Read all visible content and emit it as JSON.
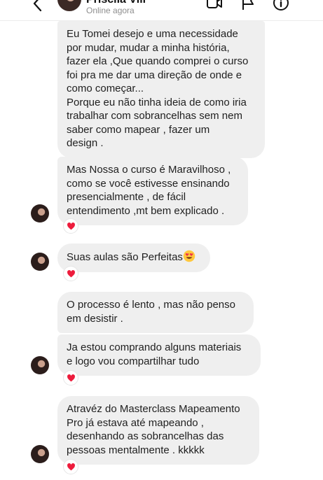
{
  "header": {
    "contact_name": "Priscila Vili",
    "status": "Online agora",
    "icons": [
      "back-chevron-icon",
      "video-call-icon",
      "flag-icon",
      "info-icon"
    ]
  },
  "messages": [
    {
      "text": "Eu Tomei desejo e uma necessidade\npor mudar, mudar a minha história,\nfazer ela ,Que quando comprei o curso\nfoi pra me dar uma direção de onde e\ncomo começar...\nPorque eu não tinha ideia de como iria\ntrabalhar com sobrancelhas sem nem\nsaber como mapear , fazer um\ndesign ."
    },
    {
      "text": "Mas Nossa o curso é Maravilhoso ,\ncomo se você estivesse ensinando\npresencialmente , de fácil\nentendimento ,mt bem explicado .",
      "reaction": "heart"
    },
    {
      "text": "Suas aulas são Perfeitas",
      "emoji": "smiling-face-with-heart-eyes",
      "reaction": "heart"
    },
    {
      "text": "O processo é lento , mas não penso\nem desistir ."
    },
    {
      "text": "Ja estou comprando alguns materiais\ne logo vou compartilhar tudo",
      "reaction": "heart"
    },
    {
      "text": "Atravéz do Masterclass Mapeamento\nPro já estava até mapeando ,\ndesenhando as sobrancelhas das\npessoas mentalmente . kkkkk",
      "reaction": "heart"
    }
  ],
  "colors": {
    "bubble": "#efefef",
    "text": "#1f1f1f",
    "heart": "#ed1c3c"
  }
}
